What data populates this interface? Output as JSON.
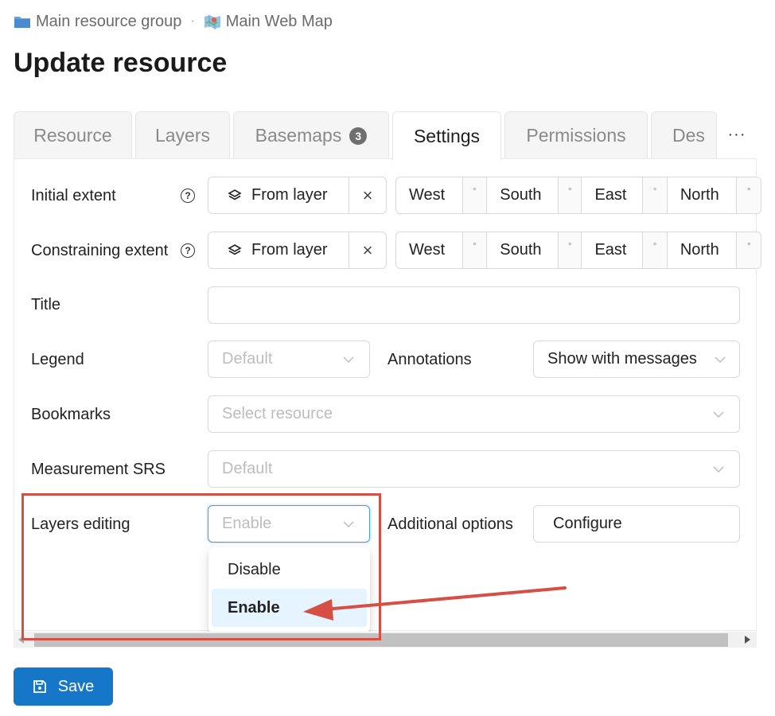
{
  "breadcrumb": [
    {
      "label": "Main resource group",
      "icon": "folder-icon"
    },
    {
      "label": "Main Web Map",
      "icon": "web-map-icon"
    }
  ],
  "breadcrumb_separator": "·",
  "title": "Update resource",
  "tabs": [
    {
      "label": "Resource",
      "active": false
    },
    {
      "label": "Layers",
      "active": false
    },
    {
      "label": "Basemaps",
      "badge": "3",
      "active": false
    },
    {
      "label": "Settings",
      "active": true
    },
    {
      "label": "Permissions",
      "active": false
    },
    {
      "label": "Des",
      "active": false
    }
  ],
  "tabs_more": "···",
  "form": {
    "initial_extent": {
      "label": "Initial extent",
      "help": "?",
      "from_layer": "From layer",
      "clear": "×",
      "west": "West",
      "south": "South",
      "east": "East",
      "north": "North",
      "deg": "°"
    },
    "constraining_extent": {
      "label": "Constraining extent",
      "help": "?",
      "from_layer": "From layer",
      "clear": "×",
      "west": "West",
      "south": "South",
      "east": "East",
      "north": "North",
      "deg": "°"
    },
    "title": {
      "label": "Title",
      "value": ""
    },
    "legend": {
      "label": "Legend",
      "placeholder": "Default"
    },
    "annotations": {
      "label": "Annotations",
      "value": "Show with messages"
    },
    "bookmarks": {
      "label": "Bookmarks",
      "placeholder": "Select resource"
    },
    "measurement_srs": {
      "label": "Measurement SRS",
      "placeholder": "Default"
    },
    "layers_editing": {
      "label": "Layers editing",
      "placeholder": "Enable",
      "options": [
        {
          "label": "Disable",
          "selected": false
        },
        {
          "label": "Enable",
          "selected": true
        }
      ]
    },
    "additional_options": {
      "label": "Additional options",
      "button": "Configure"
    }
  },
  "save_button": {
    "label": "Save",
    "icon": "save-icon"
  },
  "colors": {
    "primary": "#1677c8",
    "annotation": "#d64f45",
    "selected_option_bg": "#e6f4ff",
    "focus_border": "#4096ff"
  }
}
